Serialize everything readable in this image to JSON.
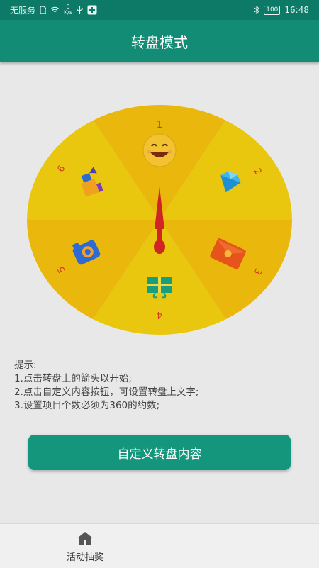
{
  "status_bar": {
    "carrier": "无服务",
    "net_speed_value": "0",
    "net_speed_unit": "K/s",
    "battery": "100",
    "time": "16:48"
  },
  "app_bar": {
    "title": "转盘模式"
  },
  "wheel": {
    "segments": [
      {
        "label": "1",
        "icon": "smiley-emoji-icon",
        "color": "#eab80c"
      },
      {
        "label": "2",
        "icon": "diamond-icon",
        "color": "#e9c70f"
      },
      {
        "label": "3",
        "icon": "red-envelope-icon",
        "color": "#eab80c"
      },
      {
        "label": "4",
        "icon": "gift-box-icon",
        "color": "#e9c70f"
      },
      {
        "label": "5",
        "icon": "camera-icon",
        "color": "#eab80c"
      },
      {
        "label": "6",
        "icon": "toy-icon",
        "color": "#e9c70f"
      }
    ],
    "pointer_color": "#d12424"
  },
  "tips": {
    "title": "提示:",
    "line1": "1.点击转盘上的箭头以开始;",
    "line2": "2.点击自定义内容按钮，可设置转盘上文字;",
    "line3": "3.设置项目个数必须为360的约数;"
  },
  "customize_button": {
    "label": "自定义转盘内容"
  },
  "bottom_nav": {
    "items": [
      {
        "label": "活动抽奖",
        "icon": "home-icon"
      }
    ]
  }
}
